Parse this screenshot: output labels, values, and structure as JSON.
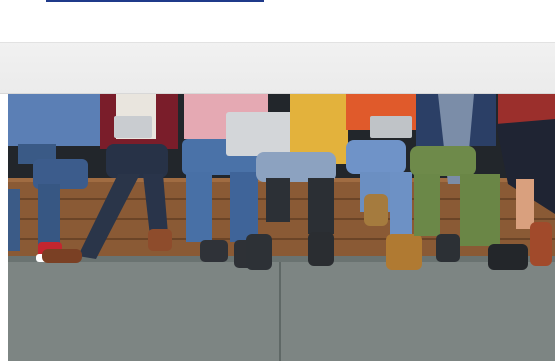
{
  "header": {
    "link_underline_color": "#1f3a8a"
  },
  "hero_image": {
    "subject": "photo",
    "colors": {
      "wall": "#1f2328",
      "bench": "#8a5a35",
      "bench_dark": "#5e3b20",
      "floor": "#7d8583",
      "floor_dark": "#5f6866"
    }
  }
}
